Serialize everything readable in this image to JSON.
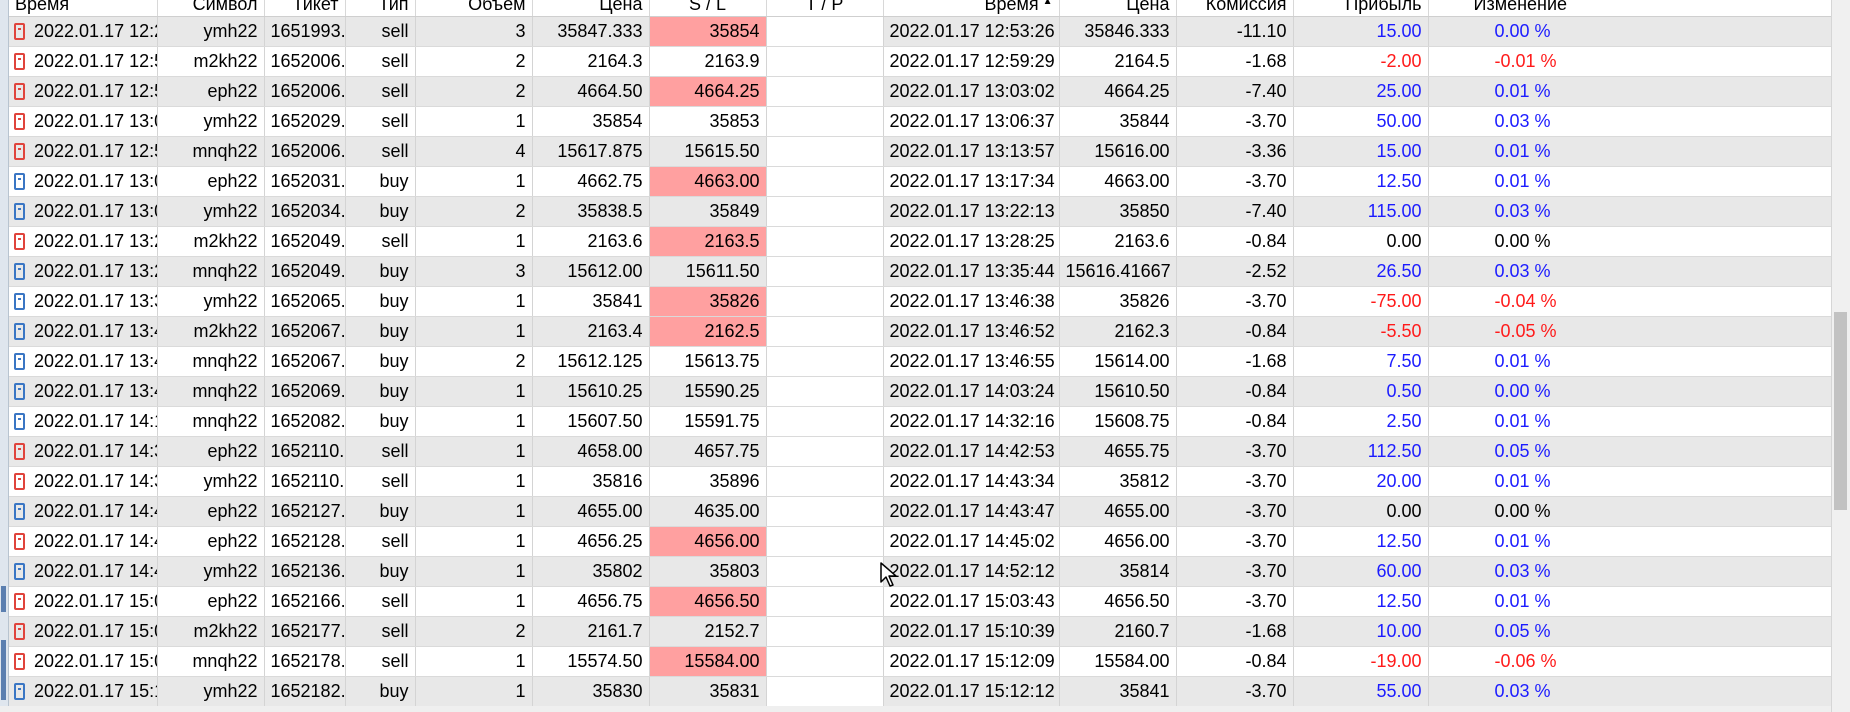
{
  "columns": [
    "Время",
    "Символ",
    "Тикет",
    "Тип",
    "Объем",
    "Цена",
    "S / L",
    "T / P",
    "Время",
    "Цена",
    "Комиссия",
    "Прибыль",
    "Изменение"
  ],
  "sort_column": "Время",
  "rows": [
    {
      "open_time": "2022.01.17 12:2...",
      "symbol": "ymh22",
      "ticket": "1651993...",
      "type": "sell",
      "volume": "3",
      "open_price": "35847.333",
      "sl": "35854",
      "sl_hit": true,
      "tp": "",
      "close_time": "2022.01.17 12:53:26",
      "close_price": "35846.333",
      "commission": "-11.10",
      "profit": "15.00",
      "change": "0.00 %",
      "sign": "pos"
    },
    {
      "open_time": "2022.01.17 12:5...",
      "symbol": "m2kh22",
      "ticket": "1652006...",
      "type": "sell",
      "volume": "2",
      "open_price": "2164.3",
      "sl": "2163.9",
      "sl_hit": false,
      "tp": "",
      "close_time": "2022.01.17 12:59:29",
      "close_price": "2164.5",
      "commission": "-1.68",
      "profit": "-2.00",
      "change": "-0.01 %",
      "sign": "neg"
    },
    {
      "open_time": "2022.01.17 12:5...",
      "symbol": "eph22",
      "ticket": "1652006...",
      "type": "sell",
      "volume": "2",
      "open_price": "4664.50",
      "sl": "4664.25",
      "sl_hit": true,
      "tp": "",
      "close_time": "2022.01.17 13:03:02",
      "close_price": "4664.25",
      "commission": "-7.40",
      "profit": "25.00",
      "change": "0.01 %",
      "sign": "pos"
    },
    {
      "open_time": "2022.01.17 13:0...",
      "symbol": "ymh22",
      "ticket": "1652029...",
      "type": "sell",
      "volume": "1",
      "open_price": "35854",
      "sl": "35853",
      "sl_hit": false,
      "tp": "",
      "close_time": "2022.01.17 13:06:37",
      "close_price": "35844",
      "commission": "-3.70",
      "profit": "50.00",
      "change": "0.03 %",
      "sign": "pos"
    },
    {
      "open_time": "2022.01.17 12:5...",
      "symbol": "mnqh22",
      "ticket": "1652006...",
      "type": "sell",
      "volume": "4",
      "open_price": "15617.875",
      "sl": "15615.50",
      "sl_hit": false,
      "tp": "",
      "close_time": "2022.01.17 13:13:57",
      "close_price": "15616.00",
      "commission": "-3.36",
      "profit": "15.00",
      "change": "0.01 %",
      "sign": "pos"
    },
    {
      "open_time": "2022.01.17 13:0...",
      "symbol": "eph22",
      "ticket": "1652031...",
      "type": "buy",
      "volume": "1",
      "open_price": "4662.75",
      "sl": "4663.00",
      "sl_hit": true,
      "tp": "",
      "close_time": "2022.01.17 13:17:34",
      "close_price": "4663.00",
      "commission": "-3.70",
      "profit": "12.50",
      "change": "0.01 %",
      "sign": "pos"
    },
    {
      "open_time": "2022.01.17 13:0...",
      "symbol": "ymh22",
      "ticket": "1652034...",
      "type": "buy",
      "volume": "2",
      "open_price": "35838.5",
      "sl": "35849",
      "sl_hit": false,
      "tp": "",
      "close_time": "2022.01.17 13:22:13",
      "close_price": "35850",
      "commission": "-7.40",
      "profit": "115.00",
      "change": "0.03 %",
      "sign": "pos"
    },
    {
      "open_time": "2022.01.17 13:2...",
      "symbol": "m2kh22",
      "ticket": "1652049...",
      "type": "sell",
      "volume": "1",
      "open_price": "2163.6",
      "sl": "2163.5",
      "sl_hit": true,
      "tp": "",
      "close_time": "2022.01.17 13:28:25",
      "close_price": "2163.6",
      "commission": "-0.84",
      "profit": "0.00",
      "change": "0.00 %",
      "sign": "zero"
    },
    {
      "open_time": "2022.01.17 13:2...",
      "symbol": "mnqh22",
      "ticket": "1652049...",
      "type": "buy",
      "volume": "3",
      "open_price": "15612.00",
      "sl": "15611.50",
      "sl_hit": false,
      "tp": "",
      "close_time": "2022.01.17 13:35:44",
      "close_price": "15616.41667",
      "commission": "-2.52",
      "profit": "26.50",
      "change": "0.03 %",
      "sign": "pos"
    },
    {
      "open_time": "2022.01.17 13:3...",
      "symbol": "ymh22",
      "ticket": "1652065...",
      "type": "buy",
      "volume": "1",
      "open_price": "35841",
      "sl": "35826",
      "sl_hit": true,
      "tp": "",
      "close_time": "2022.01.17 13:46:38",
      "close_price": "35826",
      "commission": "-3.70",
      "profit": "-75.00",
      "change": "-0.04 %",
      "sign": "neg"
    },
    {
      "open_time": "2022.01.17 13:4...",
      "symbol": "m2kh22",
      "ticket": "1652067...",
      "type": "buy",
      "volume": "1",
      "open_price": "2163.4",
      "sl": "2162.5",
      "sl_hit": true,
      "tp": "",
      "close_time": "2022.01.17 13:46:52",
      "close_price": "2162.3",
      "commission": "-0.84",
      "profit": "-5.50",
      "change": "-0.05 %",
      "sign": "neg"
    },
    {
      "open_time": "2022.01.17 13:4...",
      "symbol": "mnqh22",
      "ticket": "1652067...",
      "type": "buy",
      "volume": "2",
      "open_price": "15612.125",
      "sl": "15613.75",
      "sl_hit": false,
      "tp": "",
      "close_time": "2022.01.17 13:46:55",
      "close_price": "15614.00",
      "commission": "-1.68",
      "profit": "7.50",
      "change": "0.01 %",
      "sign": "pos"
    },
    {
      "open_time": "2022.01.17 13:4...",
      "symbol": "mnqh22",
      "ticket": "1652069...",
      "type": "buy",
      "volume": "1",
      "open_price": "15610.25",
      "sl": "15590.25",
      "sl_hit": false,
      "tp": "",
      "close_time": "2022.01.17 14:03:24",
      "close_price": "15610.50",
      "commission": "-0.84",
      "profit": "0.50",
      "change": "0.00 %",
      "sign": "pos"
    },
    {
      "open_time": "2022.01.17 14:1...",
      "symbol": "mnqh22",
      "ticket": "1652082...",
      "type": "buy",
      "volume": "1",
      "open_price": "15607.50",
      "sl": "15591.75",
      "sl_hit": false,
      "tp": "",
      "close_time": "2022.01.17 14:32:16",
      "close_price": "15608.75",
      "commission": "-0.84",
      "profit": "2.50",
      "change": "0.01 %",
      "sign": "pos"
    },
    {
      "open_time": "2022.01.17 14:3...",
      "symbol": "eph22",
      "ticket": "1652110...",
      "type": "sell",
      "volume": "1",
      "open_price": "4658.00",
      "sl": "4657.75",
      "sl_hit": false,
      "tp": "",
      "close_time": "2022.01.17 14:42:53",
      "close_price": "4655.75",
      "commission": "-3.70",
      "profit": "112.50",
      "change": "0.05 %",
      "sign": "pos"
    },
    {
      "open_time": "2022.01.17 14:3...",
      "symbol": "ymh22",
      "ticket": "1652110...",
      "type": "sell",
      "volume": "1",
      "open_price": "35816",
      "sl": "35896",
      "sl_hit": false,
      "tp": "",
      "close_time": "2022.01.17 14:43:34",
      "close_price": "35812",
      "commission": "-3.70",
      "profit": "20.00",
      "change": "0.01 %",
      "sign": "pos"
    },
    {
      "open_time": "2022.01.17 14:4...",
      "symbol": "eph22",
      "ticket": "1652127...",
      "type": "buy",
      "volume": "1",
      "open_price": "4655.00",
      "sl": "4635.00",
      "sl_hit": false,
      "tp": "",
      "close_time": "2022.01.17 14:43:47",
      "close_price": "4655.00",
      "commission": "-3.70",
      "profit": "0.00",
      "change": "0.00 %",
      "sign": "zero"
    },
    {
      "open_time": "2022.01.17 14:4...",
      "symbol": "eph22",
      "ticket": "1652128...",
      "type": "sell",
      "volume": "1",
      "open_price": "4656.25",
      "sl": "4656.00",
      "sl_hit": true,
      "tp": "",
      "close_time": "2022.01.17 14:45:02",
      "close_price": "4656.00",
      "commission": "-3.70",
      "profit": "12.50",
      "change": "0.01 %",
      "sign": "pos"
    },
    {
      "open_time": "2022.01.17 14:4...",
      "symbol": "ymh22",
      "ticket": "1652136...",
      "type": "buy",
      "volume": "1",
      "open_price": "35802",
      "sl": "35803",
      "sl_hit": false,
      "tp": "",
      "close_time": "2022.01.17 14:52:12",
      "close_price": "35814",
      "commission": "-3.70",
      "profit": "60.00",
      "change": "0.03 %",
      "sign": "pos"
    },
    {
      "open_time": "2022.01.17 15:0...",
      "symbol": "eph22",
      "ticket": "1652166...",
      "type": "sell",
      "volume": "1",
      "open_price": "4656.75",
      "sl": "4656.50",
      "sl_hit": true,
      "tp": "",
      "close_time": "2022.01.17 15:03:43",
      "close_price": "4656.50",
      "commission": "-3.70",
      "profit": "12.50",
      "change": "0.01 %",
      "sign": "pos"
    },
    {
      "open_time": "2022.01.17 15:0...",
      "symbol": "m2kh22",
      "ticket": "1652177...",
      "type": "sell",
      "volume": "2",
      "open_price": "2161.7",
      "sl": "2152.7",
      "sl_hit": false,
      "tp": "",
      "close_time": "2022.01.17 15:10:39",
      "close_price": "2160.7",
      "commission": "-1.68",
      "profit": "10.00",
      "change": "0.05 %",
      "sign": "pos"
    },
    {
      "open_time": "2022.01.17 15:0...",
      "symbol": "mnqh22",
      "ticket": "1652178...",
      "type": "sell",
      "volume": "1",
      "open_price": "15574.50",
      "sl": "15584.00",
      "sl_hit": true,
      "tp": "",
      "close_time": "2022.01.17 15:12:09",
      "close_price": "15584.00",
      "commission": "-0.84",
      "profit": "-19.00",
      "change": "-0.06 %",
      "sign": "neg"
    },
    {
      "open_time": "2022.01.17 15:1...",
      "symbol": "ymh22",
      "ticket": "1652182...",
      "type": "buy",
      "volume": "1",
      "open_price": "35830",
      "sl": "35831",
      "sl_hit": false,
      "tp": "",
      "close_time": "2022.01.17 15:12:12",
      "close_price": "35841",
      "commission": "-3.70",
      "profit": "55.00",
      "change": "0.03 %",
      "sign": "pos"
    }
  ],
  "colors": {
    "sl_hit_bg": "#ffa0a0",
    "row_alt_bg": "#e8e8e8",
    "profit_positive": "#1c1cff",
    "profit_negative": "#ff1a1a",
    "buy_icon": "#3a76c4",
    "sell_icon": "#e0443c"
  }
}
